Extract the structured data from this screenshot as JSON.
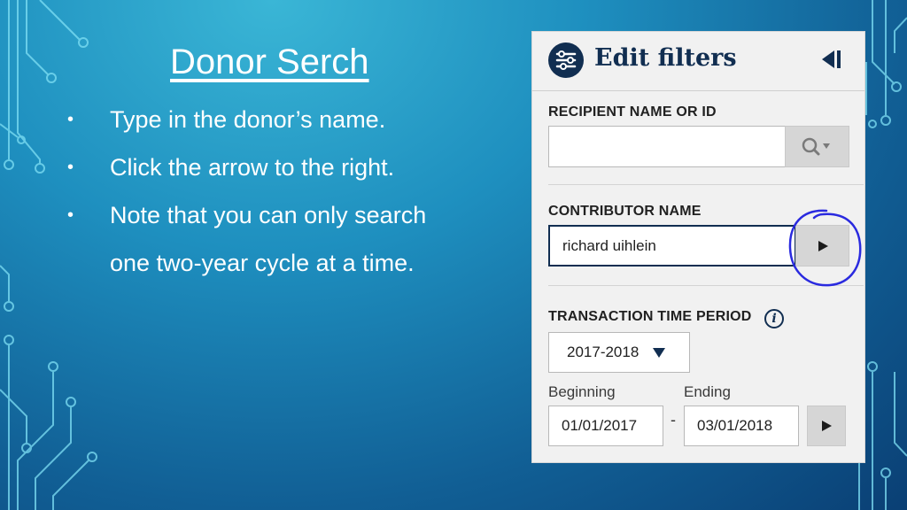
{
  "slide": {
    "title": "Donor Serch",
    "bullets": [
      "Type in the donor’s name.",
      "Click the arrow to the right.",
      "Note that you can only search",
      "one two-year cycle at a time."
    ],
    "bullet_char": "•"
  },
  "panel": {
    "header": {
      "title": "Edit filters",
      "filter_icon": "sliders-icon",
      "collapse_icon": "collapse-left-icon"
    },
    "recipient": {
      "label": "RECIPIENT NAME OR ID",
      "value": "",
      "search_icon": "search-icon"
    },
    "contributor": {
      "label": "CONTRIBUTOR NAME",
      "value": "richard uihlein",
      "go_icon": "play-arrow-icon"
    },
    "transaction": {
      "label": "TRANSACTION TIME PERIOD",
      "info_glyph": "i",
      "period_selected": "2017-2018",
      "beginning_label": "Beginning",
      "ending_label": "Ending",
      "beginning_value": "01/01/2017",
      "ending_value": "03/01/2018",
      "separator": "-"
    }
  },
  "colors": {
    "accent": "#112e51",
    "annotation": "#2a2adf"
  }
}
